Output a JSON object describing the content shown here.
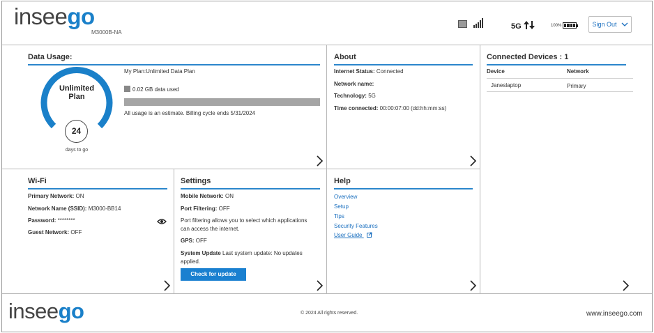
{
  "header": {
    "logo_part1": "insee",
    "logo_part2": "go",
    "model": "M3000B-NA",
    "network_type": "5G",
    "battery_percent": "100%",
    "sign_out_label": "Sign Out"
  },
  "data_usage": {
    "title": "Data Usage:",
    "ring_label_line1": "Unlimited",
    "ring_label_line2": "Plan",
    "days": "24",
    "days_label": "days to go",
    "my_plan": "My Plan:Unlimited Data Plan",
    "used": "0.02 GB data used",
    "usage_fraction": 0.0,
    "note": "All usage is an estimate. Billing cycle ends 5/31/2024",
    "accent_color": "#1a80c9"
  },
  "about": {
    "title": "About",
    "internet_status_label": "Internet Status:",
    "internet_status_value": " Connected",
    "network_name_label": "Network name:",
    "network_name_value": "",
    "technology_label": "Technology:",
    "technology_value": " 5G",
    "time_connected_label": "Time connected:",
    "time_connected_value": " 00:00:07:00 (dd:hh:mm:ss)"
  },
  "connected_devices": {
    "title": "Connected Devices : 1",
    "col_device": "Device",
    "col_network": "Network",
    "rows": [
      {
        "device": "Janeslaptop",
        "network": "Primary"
      }
    ]
  },
  "wifi": {
    "title": "Wi-Fi",
    "primary_label": "Primary Network:",
    "primary_value": " ON",
    "ssid_label": "Network Name (SSID):",
    "ssid_value": " M3000-BB14",
    "password_label": "Password:",
    "password_value": " ********",
    "guest_label": "Guest Network:",
    "guest_value": " OFF"
  },
  "settings": {
    "title": "Settings",
    "mobile_label": "Mobile Network:",
    "mobile_value": " ON",
    "port_label": "Port Filtering:",
    "port_value": " OFF",
    "port_desc_line1": "Port filtering allows you to select which applications",
    "port_desc_line2": "can access the internet.",
    "gps_label": "GPS:",
    "gps_value": " OFF",
    "update_label": "System Update",
    "update_value_line1": " Last system update: No updates",
    "update_value_line2": "applied.",
    "check_button": "Check for update"
  },
  "help": {
    "title": "Help",
    "links": [
      "Overview",
      "Setup",
      "Tips",
      "Security Features"
    ],
    "user_guide": "User Guide"
  },
  "footer": {
    "logo_part1": "insee",
    "logo_part2": "go",
    "copyright": "© 2024 All rights reserved.",
    "website": "www.inseego.com"
  }
}
